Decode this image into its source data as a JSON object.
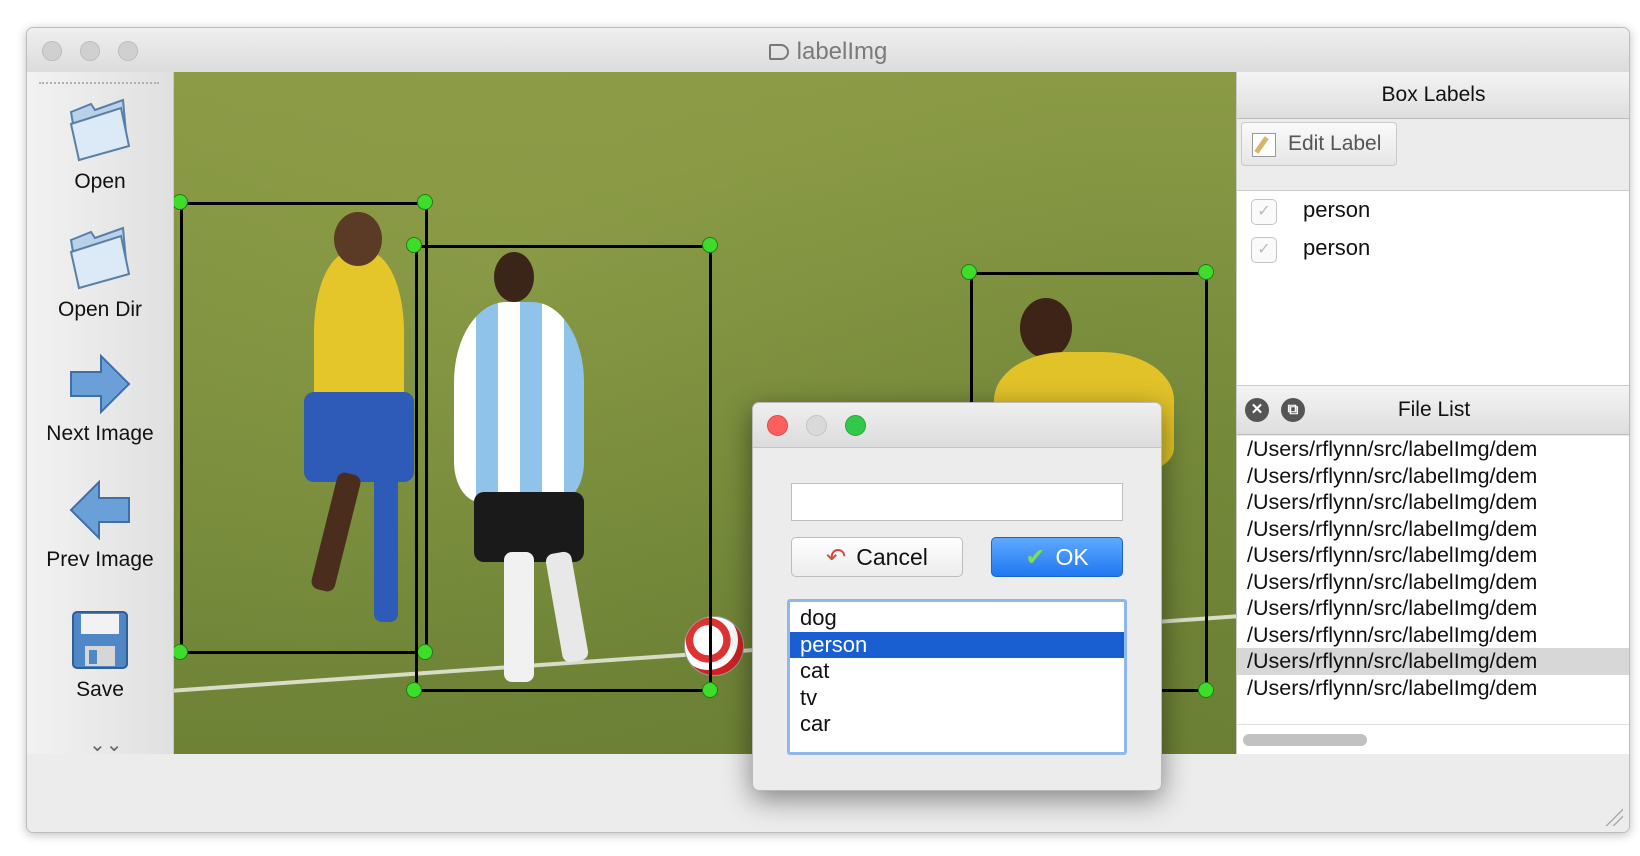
{
  "window": {
    "title": "labelImg"
  },
  "toolbar": {
    "items": [
      {
        "label": "Open",
        "icon": "folder-open-icon"
      },
      {
        "label": "Open Dir",
        "icon": "folder-open-icon"
      },
      {
        "label": "Next Image",
        "icon": "arrow-right-icon"
      },
      {
        "label": "Prev Image",
        "icon": "arrow-left-icon"
      },
      {
        "label": "Save",
        "icon": "floppy-disk-icon"
      }
    ],
    "more": "»"
  },
  "box_labels": {
    "title": "Box Labels",
    "edit_label": "Edit Label",
    "items": [
      {
        "label": "person",
        "checked": false
      },
      {
        "label": "person",
        "checked": false
      }
    ]
  },
  "file_list": {
    "title": "File List",
    "items": [
      "/Users/rflynn/src/labelImg/dem",
      "/Users/rflynn/src/labelImg/dem",
      "/Users/rflynn/src/labelImg/dem",
      "/Users/rflynn/src/labelImg/dem",
      "/Users/rflynn/src/labelImg/dem",
      "/Users/rflynn/src/labelImg/dem",
      "/Users/rflynn/src/labelImg/dem",
      "/Users/rflynn/src/labelImg/dem",
      "/Users/rflynn/src/labelImg/dem",
      "/Users/rflynn/src/labelImg/dem"
    ],
    "selected_index": 8
  },
  "label_dialog": {
    "input_value": "",
    "cancel_label": "Cancel",
    "ok_label": "OK",
    "options": [
      "dog",
      "person",
      "cat",
      "tv",
      "car"
    ],
    "selected_option": "person"
  },
  "colors": {
    "handle": "#3fdc2b",
    "box": "#000000",
    "ok_button": "#1f77f1",
    "list_selection": "#1a5fd1"
  }
}
